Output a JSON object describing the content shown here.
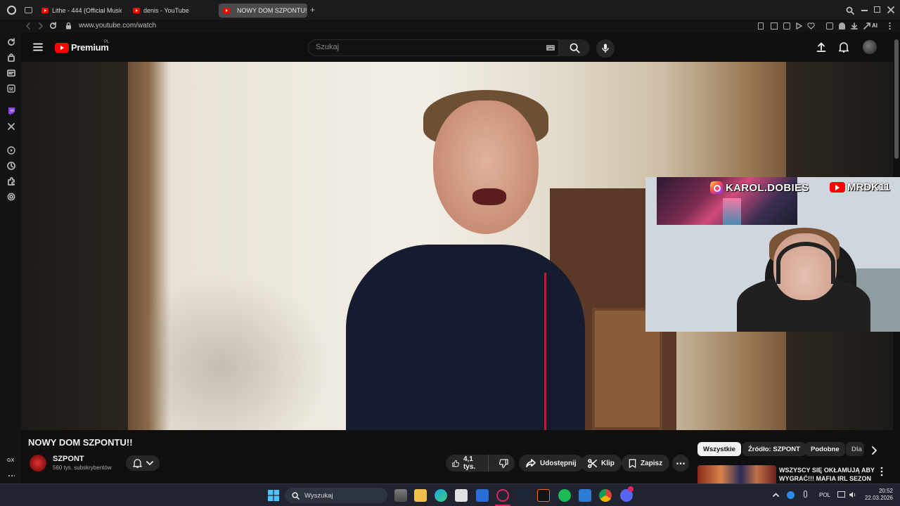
{
  "browser": {
    "tabs": [
      {
        "label": "Lithe - 444 (Official Music"
      },
      {
        "label": "denis - YouTube"
      },
      {
        "label": "NOWY DOM SZPONTU!!"
      }
    ],
    "url": "www.youtube.com/watch",
    "sidebar_icons": [
      "refresh-icon",
      "bag-icon",
      "wallet-icon",
      "messenger-icon",
      "twitch-icon",
      "x-icon",
      "player-icon",
      "history-icon",
      "extensions-icon",
      "settings-icon"
    ],
    "gx_label": "GX",
    "ai_label": "AI"
  },
  "youtube": {
    "logo_text": "Premium",
    "logo_region": "PL",
    "search_placeholder": "Szukaj",
    "video": {
      "title": "NOWY DOM SZPONTU!!",
      "channel": "SZPONT",
      "subscribers": "560 tys. subskrybentów",
      "likes": "4,1 tys.",
      "share_label": "Udostępnij",
      "clip_label": "Klip",
      "save_label": "Zapisz"
    },
    "overlay": {
      "instagram": "KAROL.DOBIES",
      "youtube": "MRDK11"
    },
    "chips": [
      {
        "label": "Wszystkie",
        "selected": true
      },
      {
        "label": "Źródło: SZPONT",
        "selected": false
      },
      {
        "label": "Podobne",
        "selected": false
      },
      {
        "label": "Dla",
        "selected": false
      }
    ],
    "recommendation": {
      "title": "WSZYSCY SIĘ OKŁAMUJĄ ABY WYGRAĆ!!! MAFIA IRL SEZON ..."
    }
  },
  "taskbar": {
    "search_label": "Wyszukaj",
    "language": "POL",
    "time": "20:52",
    "date": "22.03.2026",
    "apps": [
      "task-view",
      "file-explorer",
      "edge",
      "store",
      "mail",
      "opera-gx",
      "steam",
      "terminal",
      "spotify",
      "vscode",
      "chrome",
      "discord"
    ]
  },
  "colors": {
    "yt_red": "#ff0000",
    "background": "#0f0f0f",
    "chip_bg": "#272727",
    "taskbar_bg": "#202430"
  }
}
